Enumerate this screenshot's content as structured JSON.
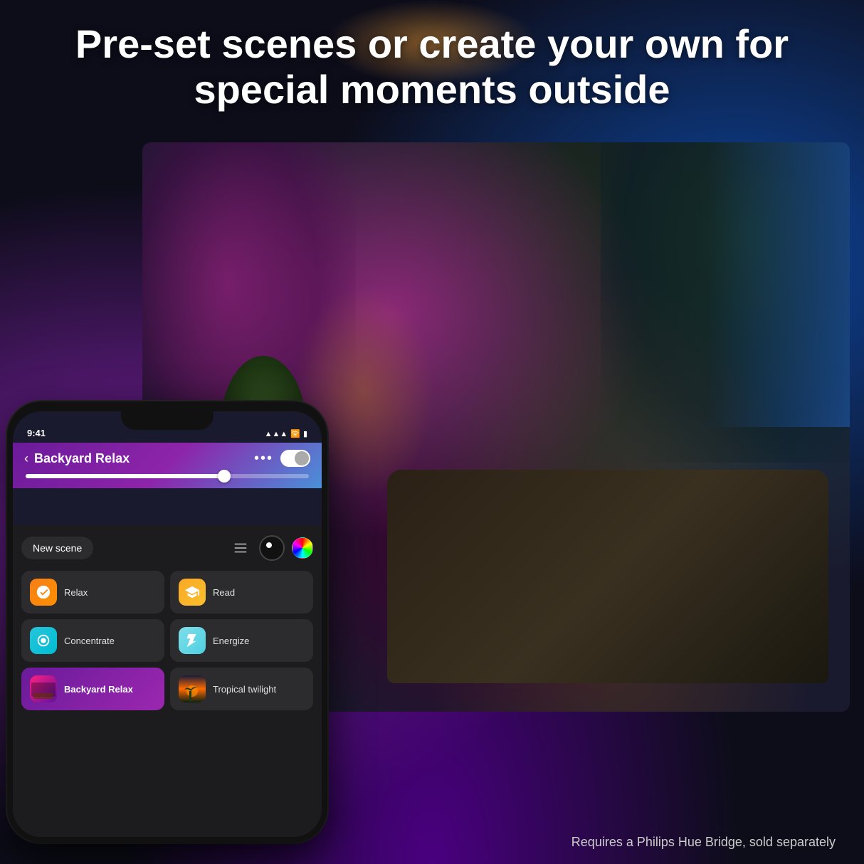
{
  "header": {
    "title": "Pre-set scenes or create your own for special moments outside"
  },
  "phone": {
    "status": {
      "time": "9:41",
      "signal": "●●●",
      "wifi": "WiFi",
      "battery": "▮▮▮"
    },
    "app": {
      "back_label": "‹",
      "title": "Backyard Relax",
      "more_label": "•••",
      "toggle_label": "toggle"
    },
    "toolbar": {
      "new_scene_label": "New scene",
      "list_icon": "list",
      "palette_icon": "palette",
      "color_icon": "color-wheel"
    },
    "scenes": [
      {
        "id": "relax",
        "label": "Relax",
        "icon_type": "relax",
        "active": false
      },
      {
        "id": "read",
        "label": "Read",
        "icon_type": "read",
        "active": false
      },
      {
        "id": "concentrate",
        "label": "Concentrate",
        "icon_type": "concentrate",
        "active": false
      },
      {
        "id": "energize",
        "label": "Energize",
        "icon_type": "energize",
        "active": false
      },
      {
        "id": "backyard",
        "label": "Backyard Relax",
        "icon_type": "backyard",
        "active": true
      },
      {
        "id": "tropical",
        "label": "Tropical twilight",
        "icon_type": "tropical",
        "active": false
      }
    ]
  },
  "footer": {
    "disclaimer": "Requires a Philips Hue Bridge, sold separately"
  },
  "detected_text": {
    "tropical_twilight": "Tropical twilight",
    "new_scene": "New scene"
  }
}
